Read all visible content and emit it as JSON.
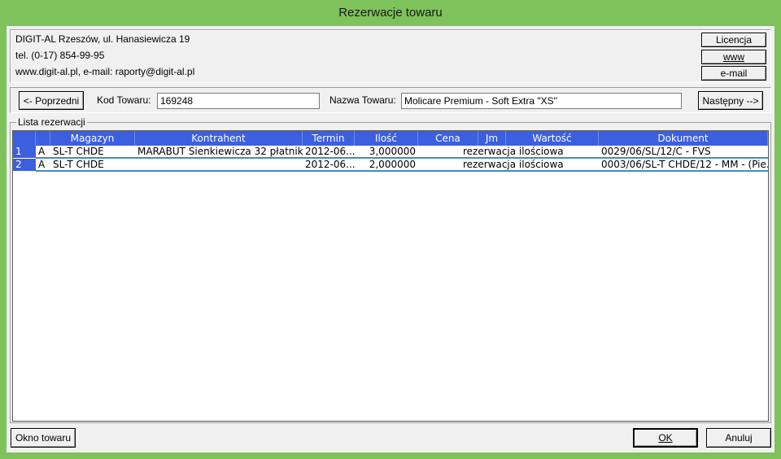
{
  "window": {
    "title": "Rezerwacje towaru"
  },
  "company": {
    "line1": "DIGIT-AL Rzeszów, ul. Hanasiewicza 19",
    "line2": "tel. (0-17) 854-99-95",
    "line3": "www.digit-al.pl,  e-mail: raporty@digit-al.pl"
  },
  "side_buttons": {
    "licencja": "Licencja",
    "www": "www",
    "email": "e-mail"
  },
  "nav": {
    "prev_label": "<- Poprzedni",
    "kod_label": "Kod Towaru:",
    "kod_value": "169248",
    "nazwa_label": "Nazwa Towaru:",
    "nazwa_value": "Molicare Premium - Soft Extra \"XS\"",
    "next_label": "Następny -->"
  },
  "list": {
    "title": "Lista rezerwacji",
    "columns": [
      "Magazyn",
      "Kontrahent",
      "Termin",
      "Ilość",
      "Cena",
      "Jm",
      "Wartość",
      "Dokument"
    ],
    "rows": [
      {
        "num": "1",
        "flag": "A",
        "magazyn": "SL-T CHDE",
        "kontrahent": "MARABUT Sienkiewicza 32 płatnik ...",
        "termin": "2012-06...",
        "ilosc": "3,000000",
        "cena": "",
        "jm_wartosc": "rezerwacja ilościowa",
        "dokument": "0029/06/SL/12/C - FVS"
      },
      {
        "num": "2",
        "flag": "A",
        "magazyn": "SL-T CHDE",
        "kontrahent": "",
        "termin": "2012-06...",
        "ilosc": "2,000000",
        "cena": "",
        "jm_wartosc": "rezerwacja ilościowa",
        "dokument": "0003/06/SL-T CHDE/12 - MM - (Pie..."
      }
    ]
  },
  "footer": {
    "okno_label": "Okno towaru",
    "ok_label": "OK",
    "anuluj_label": "Anuluj"
  }
}
